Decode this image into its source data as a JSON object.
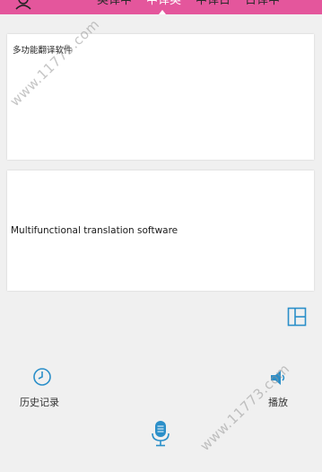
{
  "header": {
    "tabs": [
      {
        "label": "英译中",
        "active": false
      },
      {
        "label": "中译英",
        "active": true
      },
      {
        "label": "中译日",
        "active": false
      },
      {
        "label": "日译中",
        "active": false
      }
    ],
    "user_icon": "user-icon"
  },
  "source": {
    "text": "多功能翻译软件"
  },
  "target": {
    "text": "Multifunctional translation software"
  },
  "controls": {
    "layout_icon": "layout-grid-icon",
    "history_label": "历史记录",
    "history_icon": "clock-icon",
    "play_label": "播放",
    "play_icon": "speaker-icon",
    "mic_icon": "microphone-icon"
  },
  "watermark": {
    "text": "www.11773.com"
  },
  "colors": {
    "header_bg": "#e4569c",
    "accent": "#2b8fc9",
    "background": "#f0f0f0"
  }
}
